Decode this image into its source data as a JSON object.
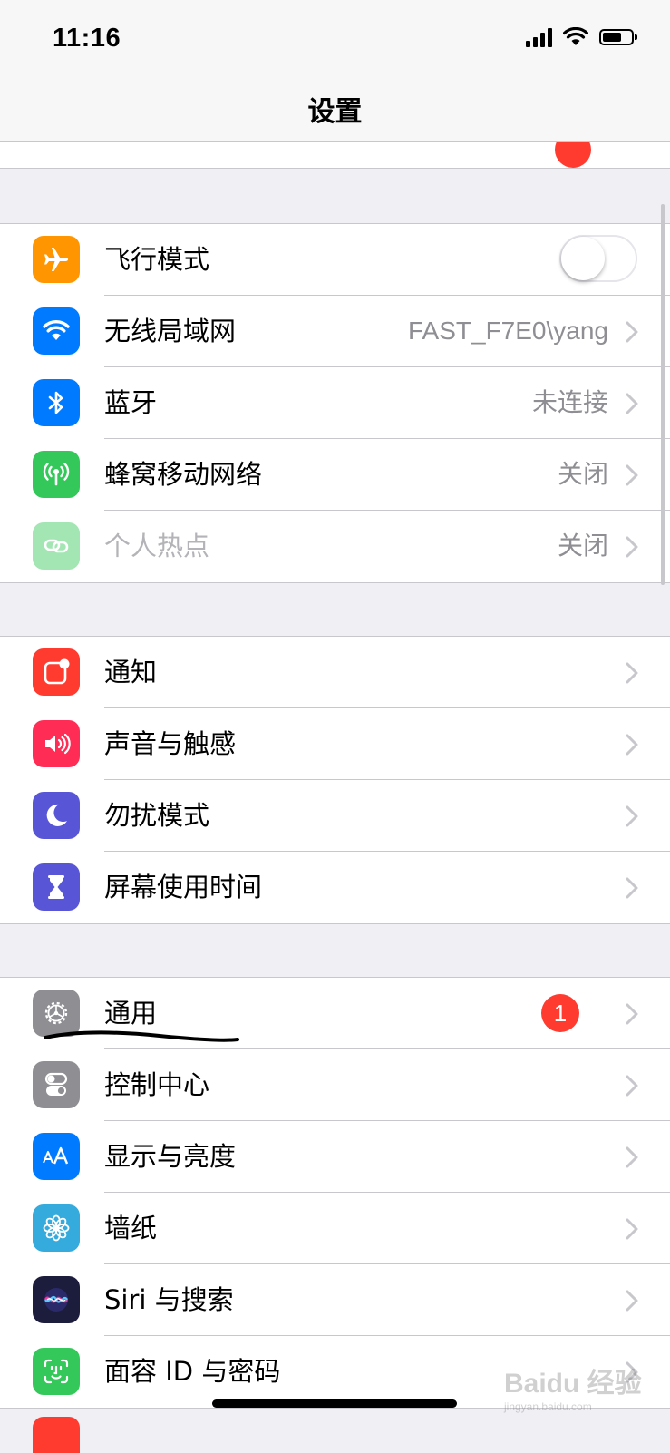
{
  "status_bar": {
    "time": "11:16",
    "signal_icon": "cellular-signal-icon",
    "wifi_icon": "wifi-icon",
    "battery_icon": "battery-icon"
  },
  "nav": {
    "title": "设置"
  },
  "groups": [
    {
      "rows": [
        {
          "label": "飞行模式",
          "icon": "airplane-icon",
          "icon_color": "#ff9500",
          "toggle": "off"
        },
        {
          "label": "无线局域网",
          "icon": "wifi-icon",
          "icon_color": "#007aff",
          "value": "FAST_F7E0\\yang"
        },
        {
          "label": "蓝牙",
          "icon": "bluetooth-icon",
          "icon_color": "#007aff",
          "value": "未连接"
        },
        {
          "label": "蜂窝移动网络",
          "icon": "cellular-antenna-icon",
          "icon_color": "#34c759",
          "value": "关闭"
        },
        {
          "label": "个人热点",
          "icon": "hotspot-icon",
          "icon_color": "#34c759",
          "value": "关闭"
        }
      ]
    },
    {
      "rows": [
        {
          "label": "通知",
          "icon": "notifications-icon",
          "icon_color": "#ff3b30"
        },
        {
          "label": "声音与触感",
          "icon": "sound-icon",
          "icon_color": "#ff2d55"
        },
        {
          "label": "勿扰模式",
          "icon": "moon-icon",
          "icon_color": "#5856d6"
        },
        {
          "label": "屏幕使用时间",
          "icon": "hourglass-icon",
          "icon_color": "#5856d6"
        }
      ]
    },
    {
      "rows": [
        {
          "label": "通用",
          "icon": "gear-icon",
          "icon_color": "#8e8e93",
          "badge": "1"
        },
        {
          "label": "控制中心",
          "icon": "toggles-icon",
          "icon_color": "#8e8e93"
        },
        {
          "label": "显示与亮度",
          "icon": "text-size-icon",
          "icon_color": "#007aff"
        },
        {
          "label": "墙纸",
          "icon": "flower-icon",
          "icon_color": "#35aadc"
        },
        {
          "label": "Siri 与搜索",
          "icon": "siri-icon",
          "icon_color": "#1c1c3c"
        },
        {
          "label": "面容 ID 与密码",
          "icon": "face-id-icon",
          "icon_color": "#34c759"
        }
      ]
    }
  ],
  "watermark": {
    "line1": "Baidu 经验",
    "line2": "jingyan.baidu.com"
  }
}
